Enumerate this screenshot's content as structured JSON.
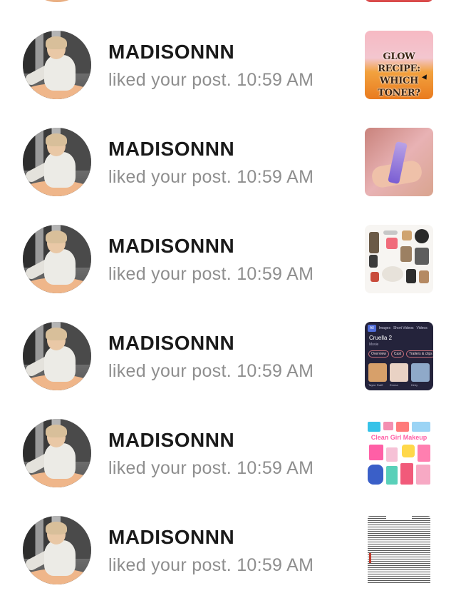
{
  "notifications": [
    {
      "username": "MADISONNN",
      "action": "liked your post.",
      "time": "10:59 AM",
      "thumbnail": "glow-recipe-post",
      "thumbnail_text": "GLOW RECIPE: WHICH TONER?"
    },
    {
      "username": "MADISONNN",
      "action": "liked your post.",
      "time": "10:59 AM",
      "thumbnail": "lip-product-post"
    },
    {
      "username": "MADISONNN",
      "action": "liked your post.",
      "time": "10:59 AM",
      "thumbnail": "outfit-collage-post"
    },
    {
      "username": "MADISONNN",
      "action": "liked your post.",
      "time": "10:59 AM",
      "thumbnail": "search-screenshot-post",
      "thumbnail_tabs": [
        "All",
        "Images",
        "Short Videos",
        "Videos"
      ],
      "thumbnail_title": "Cruella 2",
      "thumbnail_subtitle": "Movie",
      "thumbnail_chips": [
        "Overview",
        "Cast",
        "Trailers & clips"
      ],
      "thumbnail_captions": [
        "Taylor Swift",
        "Emma",
        "Kirby"
      ]
    },
    {
      "username": "MADISONNN",
      "action": "liked your post.",
      "time": "10:59 AM",
      "thumbnail": "makeup-collage-post",
      "thumbnail_text": "Clean Girl Makeup"
    },
    {
      "username": "MADISONNN",
      "action": "liked your post.",
      "time": "10:59 AM",
      "thumbnail": "document-page-post"
    }
  ]
}
